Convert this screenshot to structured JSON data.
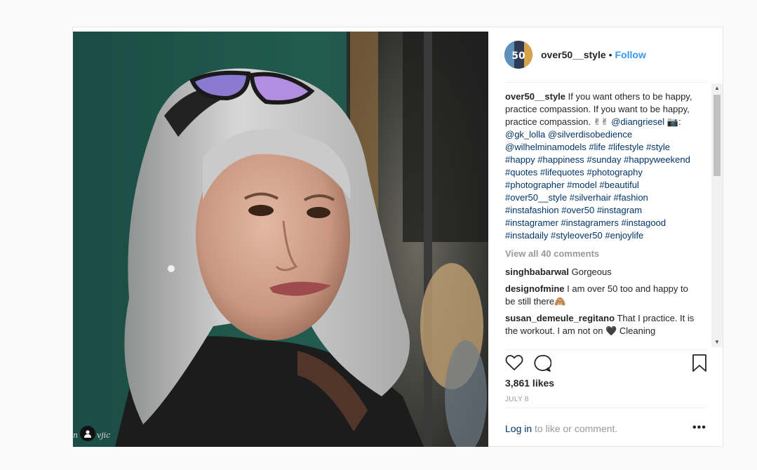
{
  "post": {
    "username": "over50__style",
    "dot": "•",
    "follow_label": "Follow",
    "avatar_icon": "profile-photo",
    "photo": {
      "watermark_left": "n",
      "watermark_right": "vjic",
      "tag_icon": "user-tag-icon"
    },
    "caption": {
      "username": "over50__style",
      "text": " If you want others to be happy, practice compassion. If you want to be happy, practice compassion. ✌✌ ",
      "mention1": "@diangriesel",
      "camera": " 📷: ",
      "mention2": "@gk_lolla",
      "mention3": "@silverdisobedience",
      "mention4": "@wilhelminamodels",
      "hashtags": "#life #lifestyle #style #happy #happiness #sunday #happyweekend #quotes #lifequotes #photography #photographer #model #beautiful #over50__style #silverhair #fashion #instafashion #over50 #instagram #instagramer #instagramers #instagood #instadaily #styleover50 #enjoylife"
    },
    "view_all": "View all 40 comments",
    "comments": [
      {
        "user": "singhbabarwal",
        "text": " Gorgeous"
      },
      {
        "user": "designofmine",
        "text": " I am over 50 too and happy to be still there🙈"
      },
      {
        "user": "susan_demeule_regitano",
        "text": " That I practice. It is the workout. I am not on 🖤 Cleaning"
      }
    ],
    "likes": "3,861 likes",
    "date": "JULY 8",
    "login_link": "Log in",
    "login_rest": " to like or comment.",
    "more_label": "•••",
    "scroll_up": "▲",
    "scroll_down": "▼"
  }
}
